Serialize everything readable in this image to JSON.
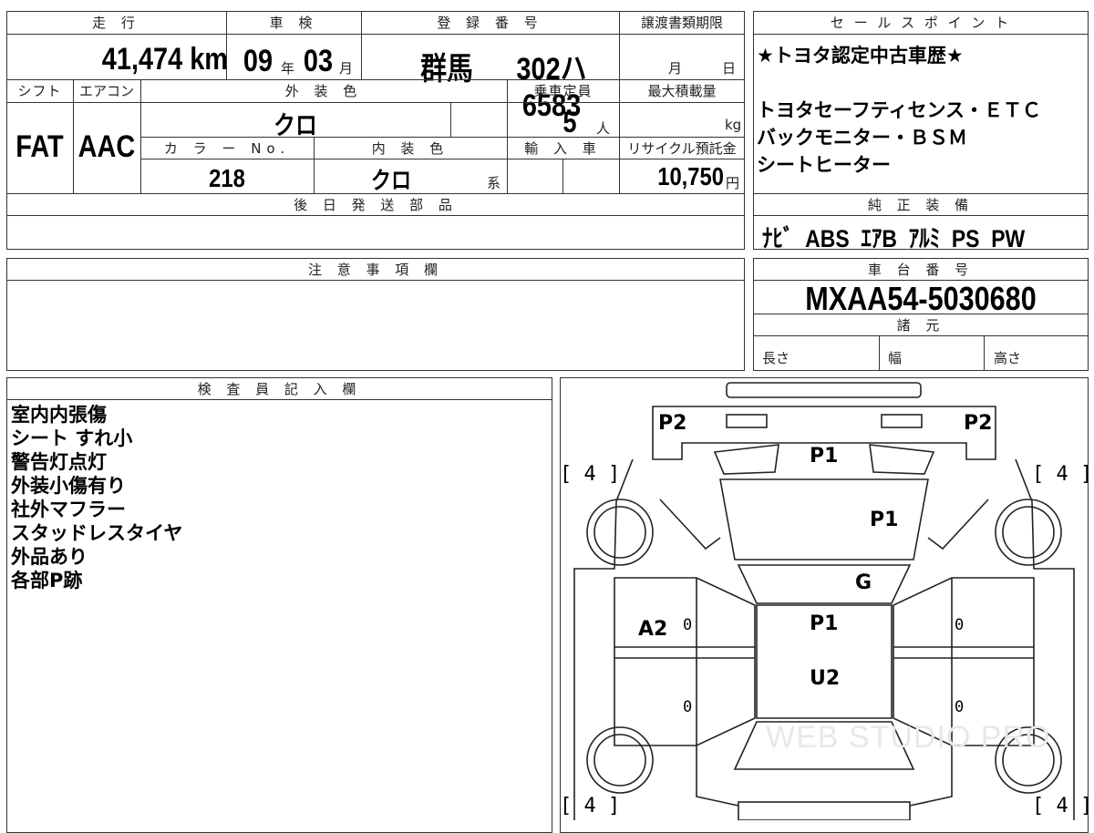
{
  "spec": {
    "mileage_label": "走 行",
    "mileage_value": "41,474 km",
    "shaken_label": "車 検",
    "shaken_year": "09",
    "shaken_year_unit": "年",
    "shaken_month": "03",
    "shaken_month_unit": "月",
    "reg_label": "登 録 番 号",
    "reg_region": "群馬",
    "reg_number": "302ハ6583",
    "transfer_label": "譲渡書類期限",
    "transfer_month_unit": "月",
    "transfer_day_unit": "日",
    "shift_label": "シフト",
    "shift_value": "FAT",
    "ac_label": "エアコン",
    "ac_value": "AAC",
    "ext_color_label": "外 装 色",
    "ext_color_value": "クロ",
    "capacity_label": "乗車定員",
    "capacity_value": "5",
    "capacity_unit": "人",
    "max_load_label": "最大積載量",
    "max_load_unit": "kg",
    "color_no_label": "カ ラ ー No.",
    "color_no_value": "218",
    "int_color_label": "内 装 色",
    "int_color_value": "クロ",
    "int_color_unit": "系",
    "import_label": "輸 入 車",
    "recycle_label": "リサイクル預託金",
    "recycle_value": "10,750",
    "recycle_unit": "円",
    "later_parts_label": "後 日 発 送 部 品"
  },
  "sales": {
    "label": "セ ー ル ス ポ イ ン ト",
    "lines": [
      "★トヨタ認定中古車歴★",
      "",
      "トヨタセーフティセンス・ＥＴＣ",
      "バックモニター・ＢＳＭ",
      "シートヒーター"
    ]
  },
  "equipment": {
    "label": "純 正 装 備",
    "items": "ﾅﾋﾞ  ABS  ｴｱB  ｱﾙﾐ  PS  PW"
  },
  "caution": {
    "label": "注 意 事 項 欄"
  },
  "chassis": {
    "label": "車 台 番 号",
    "value": "MXAA54-5030680"
  },
  "dims": {
    "label": "諸 元",
    "length": "長さ",
    "width": "幅",
    "height": "高さ"
  },
  "inspector": {
    "label": "検 査 員 記 入 欄",
    "notes": [
      "室内内張傷",
      "シート すれ小",
      "警告灯点灯",
      "外装小傷有り",
      "社外マフラー",
      "スタッドレスタイヤ",
      "外品あり",
      "各部P跡"
    ]
  },
  "diagram": {
    "marks": {
      "p2_left": "P2",
      "p2_right": "P2",
      "p1_top": "P1",
      "p1_hood": "P1",
      "g_windshield": "G",
      "a2_left_door": "A2",
      "p1_roof": "P1",
      "u2_roof": "U2"
    },
    "tires": {
      "front_left": "[ 4 ]",
      "front_right": "[ 4 ]",
      "rear_left": "[ 4 ]",
      "rear_right": "[ 4 ]"
    },
    "zeros": [
      "0",
      "0",
      "0",
      "0"
    ],
    "watermark": "WEB STUDIO PRO"
  }
}
